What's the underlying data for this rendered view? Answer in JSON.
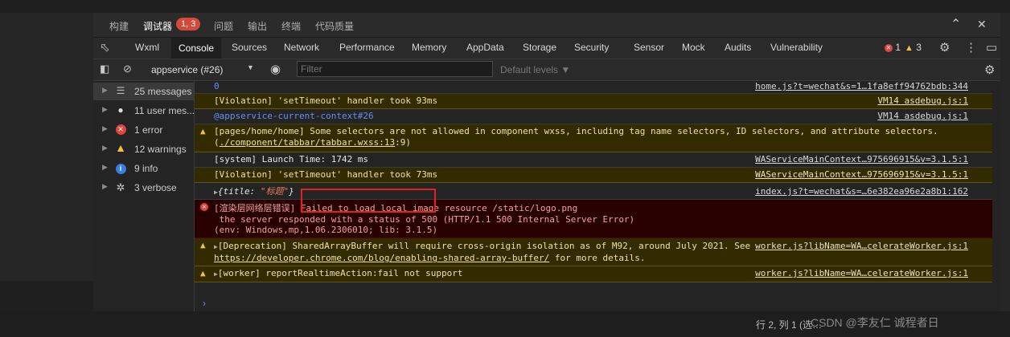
{
  "top_tabs": [
    "构建",
    "调试器",
    "问题",
    "输出",
    "终端",
    "代码质量"
  ],
  "debugger_badge": "1, 3",
  "window_controls": [
    "chevron-up-icon",
    "close-icon"
  ],
  "dev_tabs": [
    "Wxml",
    "Console",
    "Sources",
    "Network",
    "Performance",
    "Memory",
    "AppData",
    "Storage",
    "Security",
    "Sensor",
    "Mock",
    "Audits",
    "Vulnerability"
  ],
  "active_dev_tab": "Console",
  "error_count": "1",
  "warning_count": "3",
  "console_toolbar": {
    "context": "appservice (#26)",
    "filter_placeholder": "Filter",
    "levels": "Default levels ▼"
  },
  "sidebar": [
    {
      "icon": "list-icon",
      "label": "25 messages"
    },
    {
      "icon": "user-icon",
      "label": "11 user mes..."
    },
    {
      "icon": "error-icon",
      "label": "1 error"
    },
    {
      "icon": "warning-icon",
      "label": "12 warnings"
    },
    {
      "icon": "info-icon",
      "label": "9 info"
    },
    {
      "icon": "bug-icon",
      "label": "3 verbose"
    }
  ],
  "logs": [
    {
      "type": "log",
      "text": "0",
      "source": "home.js?t=wechat&s=1…1fa8eff94762bdb:344"
    },
    {
      "type": "warn",
      "text": "[Violation] 'setTimeout' handler took 93ms",
      "source": "VM14 asdebug.js:1"
    },
    {
      "type": "log",
      "text": "@appservice-current-context#26",
      "source": "VM14 asdebug.js:1"
    },
    {
      "type": "warn",
      "text": "[pages/home/home] Some selectors are not allowed in component wxss, including tag name selectors, ID selectors, and attribute selectors.(",
      "link": "./component/tabbar/tabbar.wxss:13",
      "text_end": ":9)"
    },
    {
      "type": "log",
      "text": "[system] Launch Time: 1742 ms",
      "source": "WAServiceMainContext…975696915&v=3.1.5:1"
    },
    {
      "type": "warn",
      "text": "[Violation] 'setTimeout' handler took 73ms",
      "source": "WAServiceMainContext…975696915&v=3.1.5:1"
    },
    {
      "type": "log",
      "obj_key": "title",
      "obj_value": "\"标题\"",
      "source": "index.js?t=wechat&s=…6e382ea96e2a8b1:162"
    },
    {
      "type": "error",
      "line1": "[渲染层网络层错误] Failed to load local image resource /static/logo.png",
      "line2": " the server responded with a status of 500 (HTTP/1.1 500 Internal Server Error)",
      "line3": "(env: Windows,mp,1.06.2306010; lib: 3.1.5)"
    },
    {
      "type": "warn",
      "text": "[Deprecation] SharedArrayBuffer will require cross-origin isolation as of M92, around July 2021. See",
      "link": "https://developer.chrome.com/blog/enabling-shared-array-buffer/",
      "text_end": " for more details.",
      "source": "worker.js?libName=WA…celerateWorker.js:1"
    },
    {
      "type": "warn",
      "text": "[worker] reportRealtimeAction:fail not support",
      "source": "worker.js?libName=WA…celerateWorker.js:1"
    }
  ],
  "status_bar": "行 2, 列 1 (选…",
  "watermark": "CSDN @李友仁 诚程者日"
}
